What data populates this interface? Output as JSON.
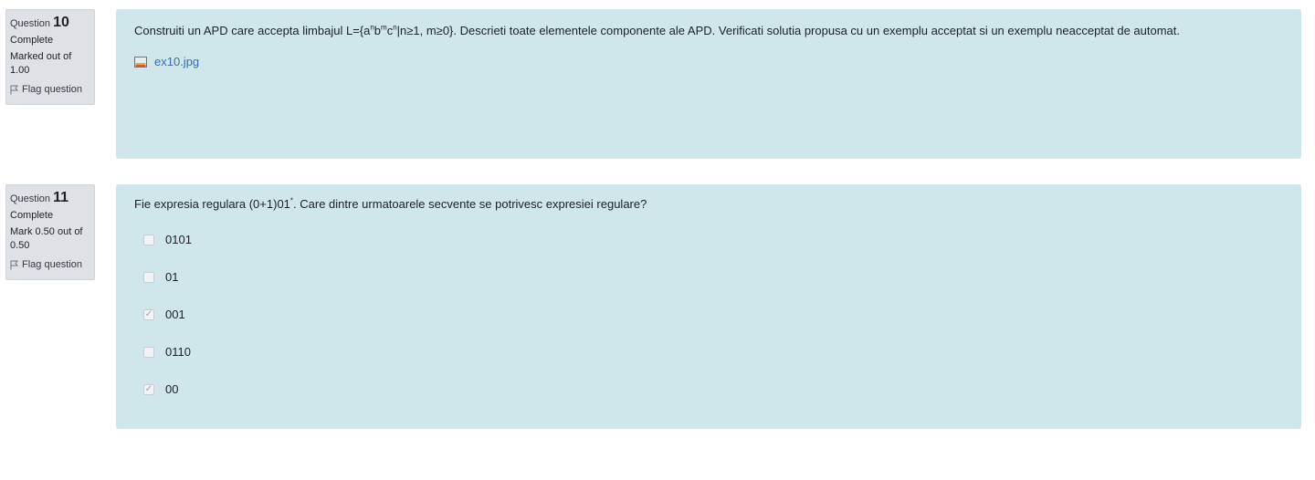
{
  "q10": {
    "question_word": "Question",
    "number": "10",
    "state": "Complete",
    "mark": "Marked out of 1.00",
    "flag_label": "Flag question",
    "text_before": "Construiti un APD care accepta limbajul L={a",
    "sup1": "n",
    "t2": "b",
    "sup2": "m",
    "t3": "c",
    "sup3": "n",
    "text_after": "|n≥1, m≥0}. Descrieti toate elementele componente ale APD. Verificati solutia propusa cu un exemplu acceptat si un exemplu neacceptat de automat.",
    "attachment": "ex10.jpg"
  },
  "q11": {
    "question_word": "Question",
    "number": "11",
    "state": "Complete",
    "mark": "Mark 0.50 out of 0.50",
    "flag_label": "Flag question",
    "text_before": "Fie expresia regulara (0+1)01",
    "sup": "*",
    "text_after": ". Care dintre urmatoarele secvente se potrivesc expresiei regulare?",
    "options": [
      {
        "label": "0101",
        "checked": false
      },
      {
        "label": "01",
        "checked": false
      },
      {
        "label": "001",
        "checked": true
      },
      {
        "label": "0110",
        "checked": false
      },
      {
        "label": "00",
        "checked": true
      }
    ]
  }
}
